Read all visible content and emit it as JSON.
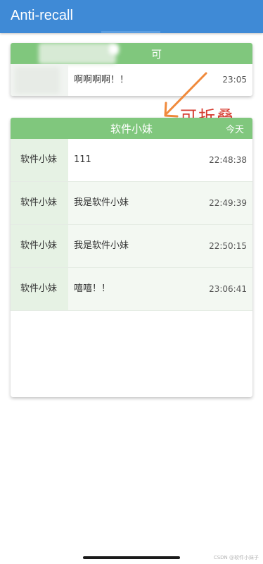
{
  "app": {
    "title": "Anti-recall"
  },
  "collapsed_card": {
    "header_char": "可",
    "message": {
      "text": "啊啊啊啊！！",
      "time": "23:05"
    }
  },
  "annotation": {
    "text": "可折叠"
  },
  "expanded_card": {
    "title": "软件小妹",
    "date": "今天",
    "messages": [
      {
        "sender": "软件小妹",
        "text": "111",
        "time": "22:48:38"
      },
      {
        "sender": "软件小妹",
        "text": "我是软件小妹",
        "time": "22:49:39"
      },
      {
        "sender": "软件小妹",
        "text": "我是软件小妹",
        "time": "22:50:15"
      },
      {
        "sender": "软件小妹",
        "text": "嘻嘻！！",
        "time": "23:06:41"
      }
    ]
  },
  "watermark": "CSDN @软件小妹子",
  "colors": {
    "appbar": "#3f8ad6",
    "header": "#80c77d",
    "sender_bg": "#e6f2e4",
    "annotation": "#d63b2f"
  }
}
